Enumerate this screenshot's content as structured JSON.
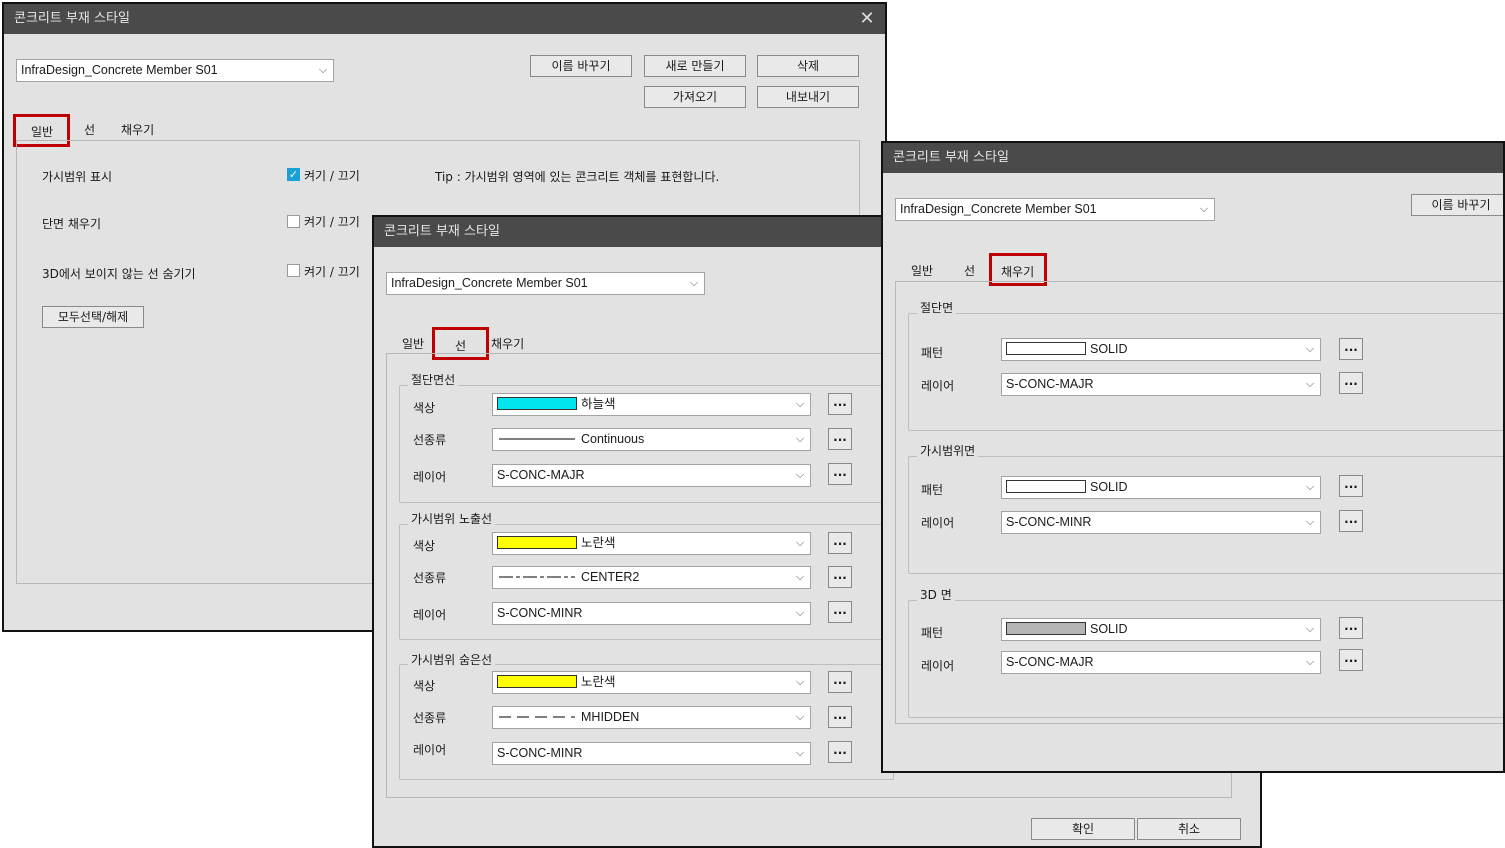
{
  "colors": {
    "titlebar": "#4a4a4a",
    "highlight": "#c00000",
    "skyblue": "#00e5ee",
    "yellow": "#ffff00",
    "gray_fill": "#b4b4b4"
  },
  "win1": {
    "title": "콘크리트 부재 스타일",
    "close": "✕",
    "style_value": "InfraDesign_Concrete Member S01",
    "buttons": {
      "rename": "이름 바꾸기",
      "new": "새로 만들기",
      "delete": "삭제",
      "import": "가져오기",
      "export": "내보내기"
    },
    "tabs": [
      "일반",
      "선",
      "채우기"
    ],
    "rows": [
      {
        "label": "가시범위 표시",
        "toggle": "켜기 / 끄기",
        "checked": true
      },
      {
        "label": "단면 채우기",
        "toggle": "켜기 / 끄기",
        "checked": false
      },
      {
        "label": "3D에서 보이지 않는 선 숨기기",
        "toggle": "켜기 / 끄기",
        "checked": false
      }
    ],
    "tip": "Tip : 가시범위 영역에 있는 콘크리트 객체를 표현합니다.",
    "select_all": "모두선택/해제"
  },
  "win2": {
    "title": "콘크리트 부재 스타일",
    "style_value": "InfraDesign_Concrete Member S01",
    "tabs": [
      "일반",
      "선",
      "채우기"
    ],
    "groups": [
      {
        "title": "절단면선",
        "rows": [
          {
            "label": "색상",
            "value": "하늘색"
          },
          {
            "label": "선종류",
            "value": "Continuous"
          },
          {
            "label": "레이어",
            "value": "S-CONC-MAJR"
          }
        ]
      },
      {
        "title": "가시범위 노출선",
        "rows": [
          {
            "label": "색상",
            "value": "노란색"
          },
          {
            "label": "선종류",
            "value": "CENTER2"
          },
          {
            "label": "레이어",
            "value": "S-CONC-MINR"
          }
        ]
      },
      {
        "title": "가시범위 숨은선",
        "rows": [
          {
            "label": "색상",
            "value": "노란색"
          },
          {
            "label": "선종류",
            "value": "MHIDDEN"
          },
          {
            "label": "레이어",
            "value": "S-CONC-MINR"
          }
        ]
      }
    ],
    "dots": "...",
    "ok": "확인",
    "cancel": "취소"
  },
  "win3": {
    "title": "콘크리트 부재 스타일",
    "style_value": "InfraDesign_Concrete Member S01",
    "rename": "이름 바꾸기",
    "tabs": [
      "일반",
      "선",
      "채우기"
    ],
    "groups": [
      {
        "title": "절단면",
        "rows": [
          {
            "label": "패턴",
            "value": "SOLID"
          },
          {
            "label": "레이어",
            "value": "S-CONC-MAJR"
          }
        ]
      },
      {
        "title": "가시범위면",
        "rows": [
          {
            "label": "패턴",
            "value": "SOLID"
          },
          {
            "label": "레이어",
            "value": "S-CONC-MINR"
          }
        ]
      },
      {
        "title": "3D 면",
        "rows": [
          {
            "label": "패턴",
            "value": "SOLID"
          },
          {
            "label": "레이어",
            "value": "S-CONC-MAJR"
          }
        ]
      }
    ],
    "dots": "..."
  }
}
